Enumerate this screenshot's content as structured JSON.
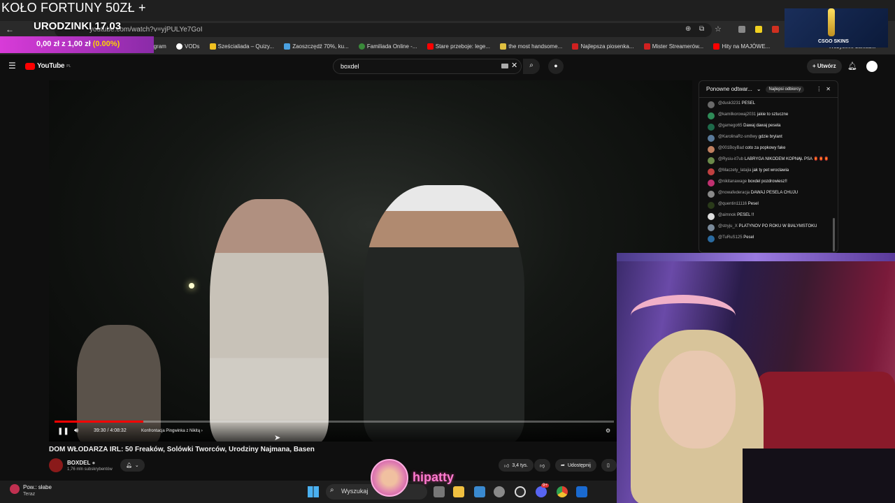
{
  "overlay": {
    "wheel_title": "KOŁO FORTUNY 50ZŁ",
    "birthday": "URODZINKI 17.03",
    "donation_amount": "0,00 zł z 1,00 zł",
    "donation_pct": "(0.00%)",
    "streamer_name": "hipatty",
    "sponsor": "CSGO SKINS"
  },
  "browser": {
    "url": "youtube.com/watch?v=yjPULYe7GoI",
    "new_tab": "+",
    "bookmarks": [
      {
        "label": "Instagram",
        "color": "#d6249f"
      },
      {
        "label": "VODs",
        "color": "#ffffff"
      },
      {
        "label": "Sześcialiada – Quizy...",
        "color": "#f0c020"
      },
      {
        "label": "Zaoszczędź 70%, ku...",
        "color": "#4aa0e0"
      },
      {
        "label": "Familiada Online -...",
        "color": "#3a8a3a"
      },
      {
        "label": "Stare przeboje: lege...",
        "color": "#ff0000"
      },
      {
        "label": "the most handsome...",
        "color": "#e0c040"
      },
      {
        "label": "Najlepsza piosenka...",
        "color": "#d02020"
      },
      {
        "label": "Mister Streamerów...",
        "color": "#d02020"
      },
      {
        "label": "Hity na MAJÓWE...",
        "color": "#ff0000"
      }
    ],
    "all_bookmarks": "Wszystkie zakładki"
  },
  "youtube": {
    "logo": "YouTube",
    "logo_region": "PL",
    "search_value": "boxdel",
    "create_label": "Utwórz",
    "video": {
      "title": "DOM WŁODARZA IRL: 50 Freaków, Solówki Tworców, Urodziny Najmana, Basen",
      "time": "39:30 / 4:08:32",
      "chapter": "Konfrontacja Pingwinka z Nikitą",
      "progress": 0.159
    },
    "channel": {
      "name": "BOXDEL",
      "subs": "1,76 mln subskrybentów"
    },
    "likes": "3,4 tys.",
    "share_label": "Udostępnij"
  },
  "chat": {
    "title": "Ponowne odtwar...",
    "badge": "Najlepsi odbiorcy",
    "messages": [
      {
        "user": "@dusk3231",
        "text": "PESEL",
        "color": "#6a6a6a"
      },
      {
        "user": "@kamilkorowaj2031",
        "text": "jakie to sztuczne",
        "color": "#2e8b57"
      },
      {
        "user": "@gamego65",
        "text": "Dawaj dawaj pesela",
        "color": "#1e6a4a"
      },
      {
        "user": "@KarolinaRz-sm8wy",
        "text": "gdzie brylant",
        "color": "#5a7a9a"
      },
      {
        "user": "@001BoyBad",
        "text": "coto za popkowy fake",
        "color": "#c08060"
      },
      {
        "user": "@Rysiu-it7ub",
        "text": "LABRYGA NIKODEM KOPNĄŁ PSA 🏮🏮🏮",
        "color": "#6a8a4a"
      },
      {
        "user": "@Maczety_latajia",
        "text": "jak ty pet wroclawia",
        "color": "#c04040"
      },
      {
        "user": "@nikitanawage",
        "text": "boxdel pozdrowiesz!!",
        "color": "#c03070"
      },
      {
        "user": "@nowafederacja",
        "text": "DAWAJ PESELA CHUJU",
        "color": "#8a8a8a"
      },
      {
        "user": "@quentin11116",
        "text": "Pesel",
        "color": "#2a3a1a"
      },
      {
        "user": "@aimnok",
        "text": "PESEL !!",
        "color": "#dddddd"
      },
      {
        "user": "@stryju_X",
        "text": "PLATYNOV PO ROKU W BIALYMSTOKU",
        "color": "#7a8a9a"
      },
      {
        "user": "@TuRuS125",
        "text": "Pesel",
        "color": "#2a6aa0"
      }
    ]
  },
  "taskbar": {
    "weather_title": "Pow.: słabe",
    "weather_sub": "Teraz",
    "search_label": "Wyszukaj",
    "discord_badge": "9+"
  }
}
